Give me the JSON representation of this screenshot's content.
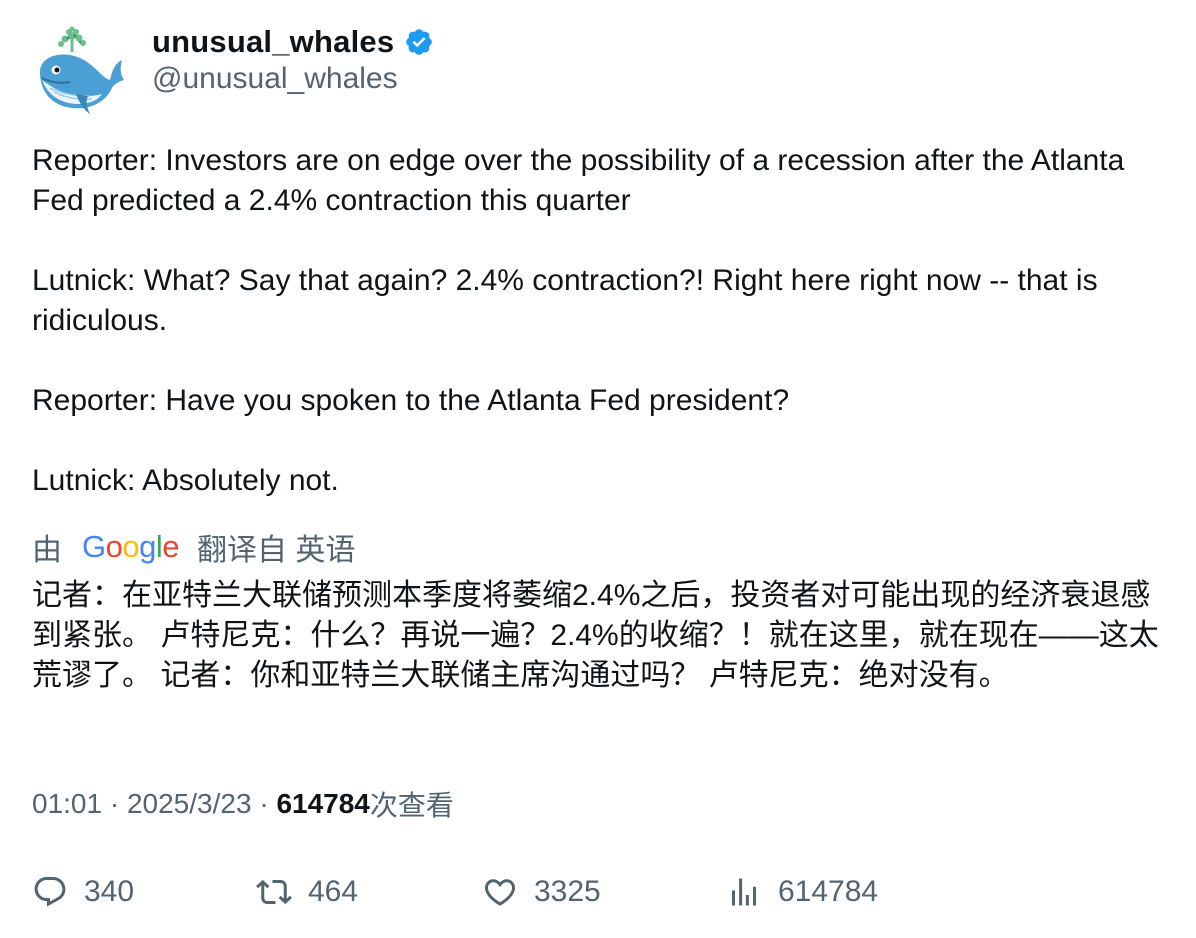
{
  "author": {
    "display_name": "unusual_whales",
    "handle": "@unusual_whales",
    "verified": true,
    "avatar_icon": "whale-avatar-icon",
    "verified_color": "#1d9bf0"
  },
  "tweet": {
    "paragraphs": [
      "Reporter: Investors are on edge over the possibility of a recession after the Atlanta Fed predicted a 2.4% contraction this quarter",
      "Lutnick: What? Say that again? 2.4% contraction?! Right here right now -- that is ridiculous.",
      "Reporter: Have you spoken to the Atlanta Fed president?",
      "Lutnick: Absolutely not."
    ]
  },
  "translation": {
    "prefix": "由",
    "provider": "Google",
    "suffix": "翻译自 英语",
    "text": "记者：在亚特兰大联储预测本季度将萎缩2.4%之后，投资者对可能出现的经济衰退感到紧张。 卢特尼克：什么？再说一遍？2.4%的收缩？！就在这里，就在现在——这太荒谬了。 记者：你和亚特兰大联储主席沟通过吗？ 卢特尼克：绝对没有。"
  },
  "meta": {
    "time": "01:01",
    "separator": " · ",
    "date": "2025/3/23",
    "views_count": "614784",
    "views_label": "次查看"
  },
  "actions": {
    "replies": "340",
    "retweets": "464",
    "likes": "3325",
    "views": "614784"
  },
  "colors": {
    "text": "#0f1419",
    "secondary": "#536471",
    "google_blue": "#4285F4",
    "google_red": "#EA4335",
    "google_yellow": "#FBBC05",
    "google_green": "#34A853"
  }
}
